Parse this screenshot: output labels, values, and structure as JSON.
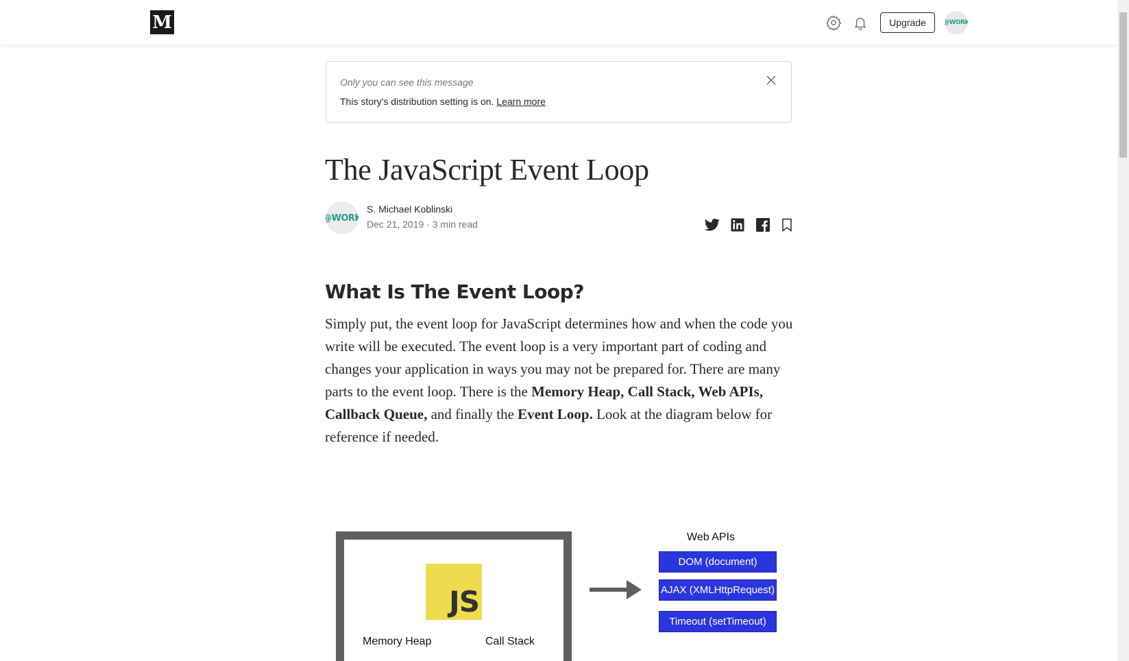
{
  "nav": {
    "logo_text": "M",
    "upgrade_label": "Upgrade",
    "avatar_text": "@WORK"
  },
  "notice": {
    "muted": "Only you can see this message",
    "text": "This story's distribution setting is on.",
    "link": "Learn more"
  },
  "article": {
    "title": "The JavaScript Event Loop",
    "author": "S. Michael Koblinski",
    "date": "Dec 21, 2019",
    "read_time": "3 min read",
    "meta_separator": " · ",
    "avatar_text": "@WORK",
    "heading": "What Is The Event Loop?",
    "p1": "Simply put, the event loop for JavaScript determines how and when the code you write will be executed. The event loop is a very important part of coding and changes your application in ways you may not be prepared for. There are many parts to the event loop. There is the ",
    "b1": "Memory Heap, Call Stack, Web APIs, Callback Queue,",
    "p2": " and finally the ",
    "b2": "Event Loop.",
    "p3": " Look at the diagram below for reference if needed."
  },
  "diagram": {
    "js_logo": "JS",
    "memory_heap": "Memory Heap",
    "call_stack": "Call Stack",
    "web_apis_title": "Web APIs",
    "apis": [
      "DOM (document)",
      "AJAX (XMLHttpRequest)",
      "Timeout (setTimeout)"
    ]
  },
  "colors": {
    "api_blue": "#2b35dc",
    "js_yellow": "#f0db4f",
    "brand_green": "#1f9f86"
  }
}
